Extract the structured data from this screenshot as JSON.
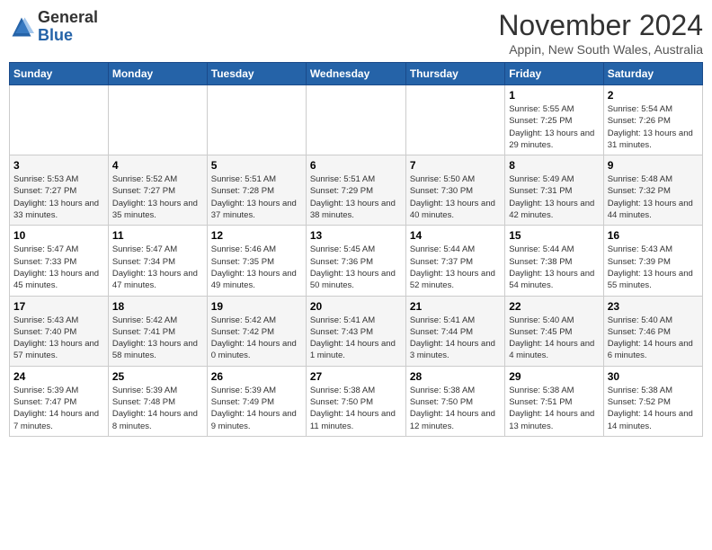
{
  "header": {
    "logo_general": "General",
    "logo_blue": "Blue",
    "month_title": "November 2024",
    "location": "Appin, New South Wales, Australia"
  },
  "days_of_week": [
    "Sunday",
    "Monday",
    "Tuesday",
    "Wednesday",
    "Thursday",
    "Friday",
    "Saturday"
  ],
  "weeks": [
    [
      {
        "day": "",
        "info": ""
      },
      {
        "day": "",
        "info": ""
      },
      {
        "day": "",
        "info": ""
      },
      {
        "day": "",
        "info": ""
      },
      {
        "day": "",
        "info": ""
      },
      {
        "day": "1",
        "info": "Sunrise: 5:55 AM\nSunset: 7:25 PM\nDaylight: 13 hours and 29 minutes."
      },
      {
        "day": "2",
        "info": "Sunrise: 5:54 AM\nSunset: 7:26 PM\nDaylight: 13 hours and 31 minutes."
      }
    ],
    [
      {
        "day": "3",
        "info": "Sunrise: 5:53 AM\nSunset: 7:27 PM\nDaylight: 13 hours and 33 minutes."
      },
      {
        "day": "4",
        "info": "Sunrise: 5:52 AM\nSunset: 7:27 PM\nDaylight: 13 hours and 35 minutes."
      },
      {
        "day": "5",
        "info": "Sunrise: 5:51 AM\nSunset: 7:28 PM\nDaylight: 13 hours and 37 minutes."
      },
      {
        "day": "6",
        "info": "Sunrise: 5:51 AM\nSunset: 7:29 PM\nDaylight: 13 hours and 38 minutes."
      },
      {
        "day": "7",
        "info": "Sunrise: 5:50 AM\nSunset: 7:30 PM\nDaylight: 13 hours and 40 minutes."
      },
      {
        "day": "8",
        "info": "Sunrise: 5:49 AM\nSunset: 7:31 PM\nDaylight: 13 hours and 42 minutes."
      },
      {
        "day": "9",
        "info": "Sunrise: 5:48 AM\nSunset: 7:32 PM\nDaylight: 13 hours and 44 minutes."
      }
    ],
    [
      {
        "day": "10",
        "info": "Sunrise: 5:47 AM\nSunset: 7:33 PM\nDaylight: 13 hours and 45 minutes."
      },
      {
        "day": "11",
        "info": "Sunrise: 5:47 AM\nSunset: 7:34 PM\nDaylight: 13 hours and 47 minutes."
      },
      {
        "day": "12",
        "info": "Sunrise: 5:46 AM\nSunset: 7:35 PM\nDaylight: 13 hours and 49 minutes."
      },
      {
        "day": "13",
        "info": "Sunrise: 5:45 AM\nSunset: 7:36 PM\nDaylight: 13 hours and 50 minutes."
      },
      {
        "day": "14",
        "info": "Sunrise: 5:44 AM\nSunset: 7:37 PM\nDaylight: 13 hours and 52 minutes."
      },
      {
        "day": "15",
        "info": "Sunrise: 5:44 AM\nSunset: 7:38 PM\nDaylight: 13 hours and 54 minutes."
      },
      {
        "day": "16",
        "info": "Sunrise: 5:43 AM\nSunset: 7:39 PM\nDaylight: 13 hours and 55 minutes."
      }
    ],
    [
      {
        "day": "17",
        "info": "Sunrise: 5:43 AM\nSunset: 7:40 PM\nDaylight: 13 hours and 57 minutes."
      },
      {
        "day": "18",
        "info": "Sunrise: 5:42 AM\nSunset: 7:41 PM\nDaylight: 13 hours and 58 minutes."
      },
      {
        "day": "19",
        "info": "Sunrise: 5:42 AM\nSunset: 7:42 PM\nDaylight: 14 hours and 0 minutes."
      },
      {
        "day": "20",
        "info": "Sunrise: 5:41 AM\nSunset: 7:43 PM\nDaylight: 14 hours and 1 minute."
      },
      {
        "day": "21",
        "info": "Sunrise: 5:41 AM\nSunset: 7:44 PM\nDaylight: 14 hours and 3 minutes."
      },
      {
        "day": "22",
        "info": "Sunrise: 5:40 AM\nSunset: 7:45 PM\nDaylight: 14 hours and 4 minutes."
      },
      {
        "day": "23",
        "info": "Sunrise: 5:40 AM\nSunset: 7:46 PM\nDaylight: 14 hours and 6 minutes."
      }
    ],
    [
      {
        "day": "24",
        "info": "Sunrise: 5:39 AM\nSunset: 7:47 PM\nDaylight: 14 hours and 7 minutes."
      },
      {
        "day": "25",
        "info": "Sunrise: 5:39 AM\nSunset: 7:48 PM\nDaylight: 14 hours and 8 minutes."
      },
      {
        "day": "26",
        "info": "Sunrise: 5:39 AM\nSunset: 7:49 PM\nDaylight: 14 hours and 9 minutes."
      },
      {
        "day": "27",
        "info": "Sunrise: 5:38 AM\nSunset: 7:50 PM\nDaylight: 14 hours and 11 minutes."
      },
      {
        "day": "28",
        "info": "Sunrise: 5:38 AM\nSunset: 7:50 PM\nDaylight: 14 hours and 12 minutes."
      },
      {
        "day": "29",
        "info": "Sunrise: 5:38 AM\nSunset: 7:51 PM\nDaylight: 14 hours and 13 minutes."
      },
      {
        "day": "30",
        "info": "Sunrise: 5:38 AM\nSunset: 7:52 PM\nDaylight: 14 hours and 14 minutes."
      }
    ]
  ]
}
